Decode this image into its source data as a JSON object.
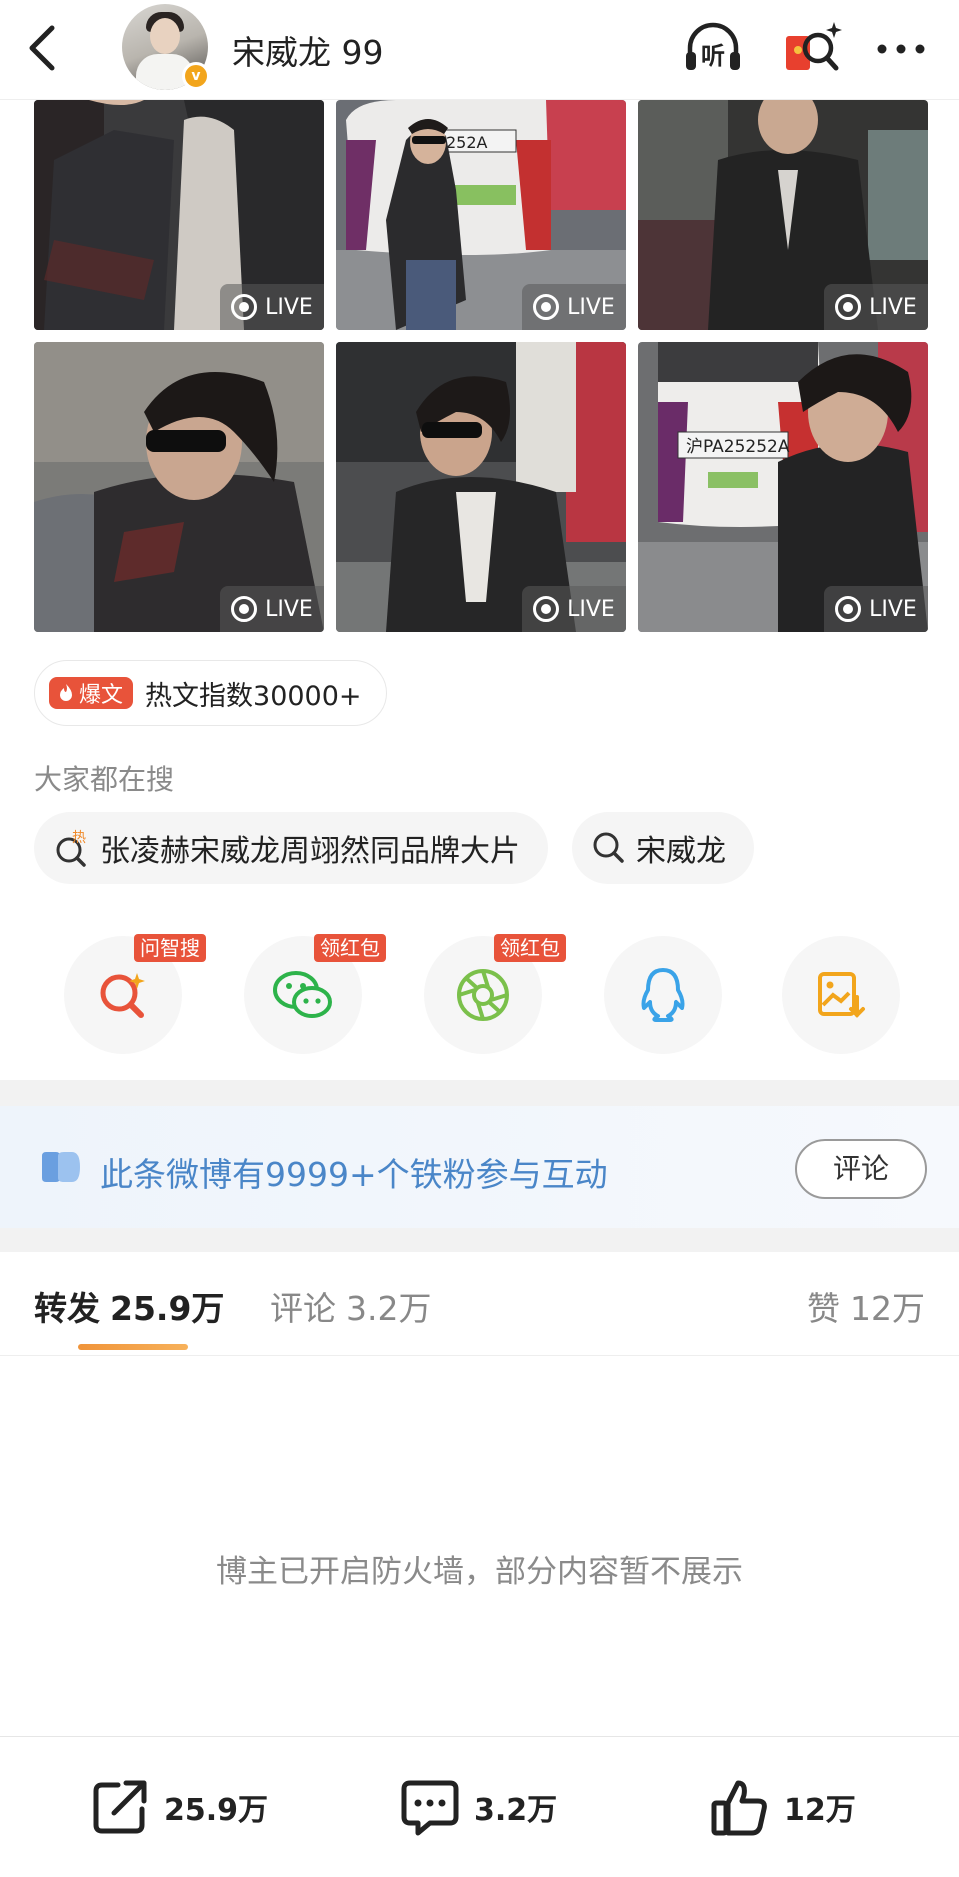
{
  "header": {
    "username": "宋威龙 99",
    "verified_badge": "v",
    "icons": [
      "back-icon",
      "listen-icon",
      "red-packet-search-icon",
      "more-icon"
    ],
    "listen_label": "听"
  },
  "photos": [
    {
      "live": "LIVE"
    },
    {
      "live": "LIVE"
    },
    {
      "live": "LIVE"
    },
    {
      "live": "LIVE"
    },
    {
      "live": "LIVE"
    },
    {
      "live": "LIVE"
    }
  ],
  "hot": {
    "tag": "爆文",
    "text": "热文指数30000+"
  },
  "searching": {
    "title": "大家都在搜",
    "chips": [
      {
        "label": "张凌赫宋威龙周翊然同品牌大片",
        "hot_mark": "热"
      },
      {
        "label": "宋威龙"
      }
    ]
  },
  "share": [
    {
      "icon": "ai-search-icon",
      "tag": "问智搜",
      "color": "#e8533a"
    },
    {
      "icon": "wechat-icon",
      "tag": "领红包",
      "color": "#2db34a"
    },
    {
      "icon": "moments-icon",
      "tag": "领红包",
      "color": "#7bc04b"
    },
    {
      "icon": "qq-icon",
      "tag": "",
      "color": "#3aa3e8"
    },
    {
      "icon": "save-image-icon",
      "tag": "",
      "color": "#f2a51c"
    }
  ],
  "fans_banner": {
    "text": "此条微博有9999+个铁粉参与互动",
    "button": "评论"
  },
  "tabs": {
    "repost": {
      "label": "转发",
      "count": "25.9万"
    },
    "comment": {
      "label": "评论",
      "count": "3.2万"
    },
    "like": {
      "label": "赞",
      "count": "12万"
    }
  },
  "empty_message": "博主已开启防火墙，部分内容暂不展示",
  "bottom": {
    "repost": "25.9万",
    "comment": "3.2万",
    "like": "12万"
  }
}
